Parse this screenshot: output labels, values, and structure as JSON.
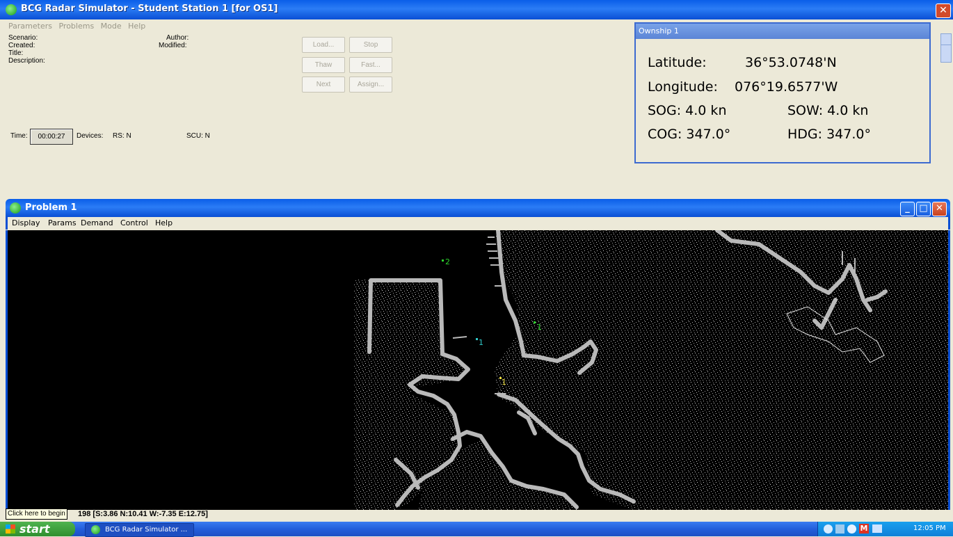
{
  "app": {
    "title": "BCG Radar Simulator - Student Station 1 [for OS1]",
    "close_glyph": "✕",
    "menu": [
      "Parameters",
      "Problems",
      "Mode",
      "Help"
    ]
  },
  "info": {
    "scenario": "Scenario:",
    "created": "Created:",
    "title": "Title:",
    "description": "Description:",
    "author": "Author:",
    "modified": "Modified:"
  },
  "buttons": {
    "load": "Load...",
    "stop": "Stop",
    "thaw": "Thaw",
    "fast": "Fast...",
    "next": "Next",
    "assign": "Assign..."
  },
  "time": {
    "label": "Time:",
    "value": "00:00:27",
    "devices": "Devices:",
    "rs": "RS:  N",
    "scu": "SCU: N"
  },
  "ownship": {
    "title": "Ownship 1",
    "lat_label": "Latitude:",
    "lat_value": "36°53.0748'N",
    "lon_label": "Longitude:",
    "lon_value": "076°19.6577'W",
    "sog": "SOG: 4.0 kn",
    "sow": "SOW: 4.0 kn",
    "cog": "COG: 347.0°",
    "hdg": "HDG: 347.0°"
  },
  "problem": {
    "title": "Problem 1",
    "menu": [
      "Display",
      "Params",
      "Demand",
      "Control",
      "Help"
    ],
    "targets": [
      {
        "label": "2",
        "color": "#2cd22c"
      },
      {
        "label": "1",
        "color": "#2cd22c"
      },
      {
        "label": "1",
        "color": "#30c8c8"
      },
      {
        "label": "1",
        "color": "#e8d83a"
      }
    ],
    "status": "198  [S:3.86  N:10.41  W:-7.35  E:12.75]"
  },
  "tooltip": "Click here to begin",
  "taskbar": {
    "start": "start",
    "item": "BCG Radar Simulator ...",
    "clock": "12:05 PM"
  },
  "colors": {
    "xp_blue": "#0a5ee8",
    "radar_land": "#b9b9b9",
    "radar_bg": "#000000"
  }
}
